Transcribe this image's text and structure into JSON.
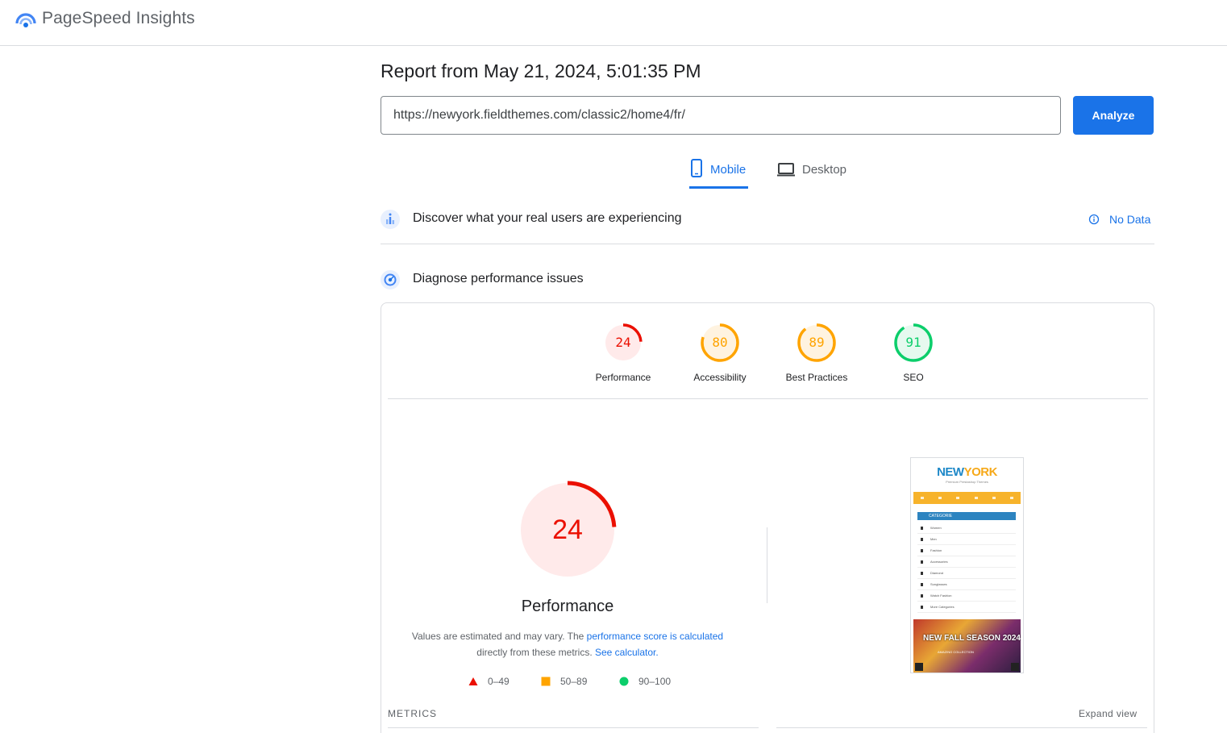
{
  "header": {
    "brand": "PageSpeed Insights",
    "logo_icon": "pagespeed-logo-icon"
  },
  "report": {
    "title": "Report from May 21, 2024, 5:01:35 PM",
    "url_value": "https://newyork.fieldthemes.com/classic2/home4/fr/",
    "analyze_label": "Analyze"
  },
  "tabs": [
    {
      "label": "Mobile",
      "icon": "phone-icon",
      "active": true
    },
    {
      "label": "Desktop",
      "icon": "laptop-icon",
      "active": false
    }
  ],
  "field_section": {
    "title": "Discover what your real users are experiencing",
    "status": "No Data",
    "icon": "users-chart-icon",
    "status_icon": "info-icon"
  },
  "lab_section": {
    "title": "Diagnose performance issues",
    "icon": "lab-gauge-icon"
  },
  "scores": [
    {
      "label": "Performance",
      "value": "24",
      "color": "#eb0f00",
      "bg": "#ffeaea",
      "fraction": 0.24
    },
    {
      "label": "Accessibility",
      "value": "80",
      "color": "#ffa400",
      "bg": "#fff3e0",
      "fraction": 0.8
    },
    {
      "label": "Best Practices",
      "value": "89",
      "color": "#ffa400",
      "bg": "#fff3e0",
      "fraction": 0.89
    },
    {
      "label": "SEO",
      "value": "91",
      "color": "#0cce6b",
      "bg": "#e6f9ef",
      "fraction": 0.91
    }
  ],
  "performance": {
    "score": "24",
    "fraction": 0.24,
    "title": "Performance",
    "note_prefix": "Values are estimated and may vary. The ",
    "note_link1": "performance score is calculated",
    "note_mid": " directly from these metrics. ",
    "note_link2": "See calculator."
  },
  "legend": [
    {
      "range": "0–49",
      "shape": "triangle",
      "color": "#eb0f00"
    },
    {
      "range": "50–89",
      "shape": "square",
      "color": "#ffa400"
    },
    {
      "range": "90–100",
      "shape": "circle",
      "color": "#0cce6b"
    }
  ],
  "metrics": {
    "label": "METRICS",
    "expand_label": "Expand view"
  },
  "screenshot": {
    "logo_a": "NEW",
    "logo_b": "YORK",
    "subtitle": "Premium Prestashop Themes",
    "category": "CATEGORIE",
    "items": [
      "Women",
      "Men",
      "Fashion",
      "Accessories",
      "Diamond",
      "Sunglasses",
      "Watch Fashion",
      "More Categories"
    ],
    "banner_title": "NEW FALL SEASON 2024",
    "banner_sub": "AMAZING COLLECTION"
  }
}
